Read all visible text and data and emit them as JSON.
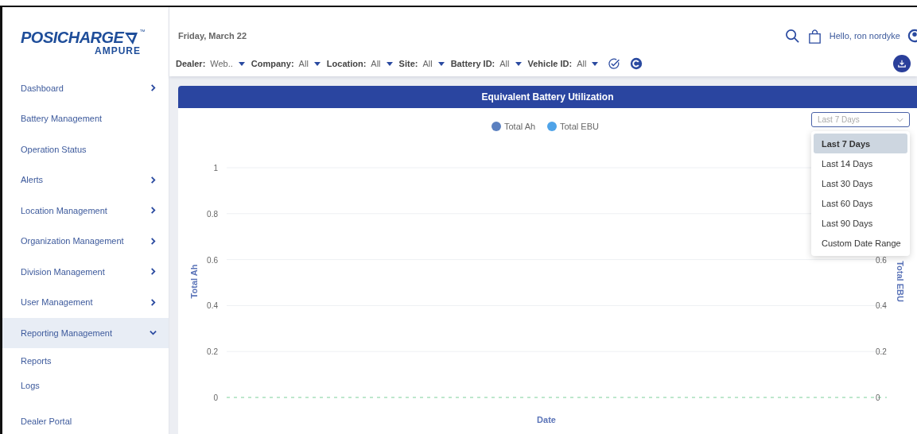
{
  "logo": {
    "brand": "POSICHARGE",
    "trademark": "™",
    "sub_brand": "AMPURE"
  },
  "sidebar": {
    "items": [
      {
        "label": "Dashboard",
        "kind": "collapsed",
        "selected": false
      },
      {
        "label": "Battery Management",
        "kind": "plain",
        "selected": false
      },
      {
        "label": "Operation Status",
        "kind": "plain",
        "selected": false
      },
      {
        "label": "Alerts",
        "kind": "collapsed",
        "selected": false
      },
      {
        "label": "Location Management",
        "kind": "collapsed",
        "selected": false
      },
      {
        "label": "Organization Management",
        "kind": "collapsed",
        "selected": false
      },
      {
        "label": "Division Management",
        "kind": "collapsed",
        "selected": false
      },
      {
        "label": "User Management",
        "kind": "collapsed",
        "selected": false
      },
      {
        "label": "Reporting Management",
        "kind": "expanded",
        "selected": true,
        "children": [
          {
            "label": "Reports"
          },
          {
            "label": "Logs"
          }
        ]
      },
      {
        "label": "Dealer Portal",
        "kind": "plain",
        "selected": false
      }
    ]
  },
  "header": {
    "date": "Friday, March 22",
    "greeting": "Hello, ron nordyke"
  },
  "filters": [
    {
      "label": "Dealer:",
      "value": "Web.."
    },
    {
      "label": "Company:",
      "value": "All"
    },
    {
      "label": "Location:",
      "value": "All"
    },
    {
      "label": "Site:",
      "value": "All"
    },
    {
      "label": "Battery ID:",
      "value": "All"
    },
    {
      "label": "Vehicle ID:",
      "value": "All"
    }
  ],
  "panel": {
    "title": "Equivalent Battery Utilization",
    "range_select": {
      "value": "Last 7 Days",
      "expanded": true,
      "options": [
        {
          "label": "Last 7 Days",
          "selected": true
        },
        {
          "label": "Last 14 Days",
          "selected": false
        },
        {
          "label": "Last 30 Days",
          "selected": false
        },
        {
          "label": "Last 60 Days",
          "selected": false
        },
        {
          "label": "Last 90 Days",
          "selected": false
        },
        {
          "label": "Custom Date Range",
          "selected": false
        }
      ]
    },
    "right_axis": {
      "label": "Total EBU",
      "ticks": [
        "0.6",
        "0.4",
        "0.2",
        "0"
      ]
    },
    "chart_data": {
      "type": "line",
      "xlabel": "Date",
      "ylabel": "Total Ah",
      "ylim": [
        0,
        1
      ],
      "grid": true,
      "yticks": [
        0,
        0.2,
        0.4,
        0.6,
        0.8,
        1
      ],
      "series": [
        {
          "name": "Total Ah",
          "color": "#5b80c0"
        },
        {
          "name": "Total EBU",
          "color": "#4fa3e8"
        }
      ]
    }
  }
}
